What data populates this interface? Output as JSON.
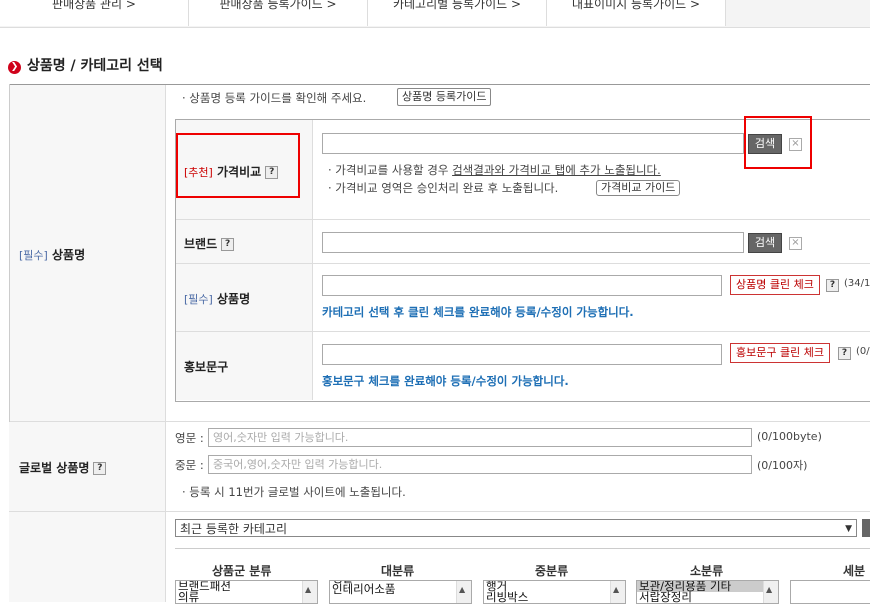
{
  "top_tabs": [
    {
      "label": "판매상품 관리 >"
    },
    {
      "label": "판매상품 등록가이드 >"
    },
    {
      "label": "카테고리별 등록가이드 >"
    },
    {
      "label": "대표이미지 등록가이드 >"
    }
  ],
  "section_title": "상품명 / 카테고리 선택",
  "product_name_section": {
    "req_tag": "[필수]",
    "label": "상품명",
    "guide_text": "· 상품명 등록 가이드를 확인해 주세요.",
    "guide_button": "상품명 등록가이드",
    "price_compare": {
      "rec_tag": "[추천]",
      "label": "가격비교",
      "search_button": "검색",
      "close": "×",
      "note1_prefix": "· 가격비교를 사용할 경우 ",
      "note1_link": "검색결과와 가격비교 탭에 추가 노출됩니다.",
      "note2": "· 가격비교 영역은 승인처리 완료 후 노출됩니다.",
      "note2_button": "가격비교 가이드"
    },
    "brand": {
      "label": "브랜드",
      "search_button": "검색",
      "close": "×"
    },
    "name": {
      "req_tag": "[필수]",
      "label": "상품명",
      "check_button": "상품명 클린 체크",
      "counter": "(34/1",
      "note": "카테고리 선택 후 클린 체크를 완료해야 등록/수정이 가능합니다."
    },
    "promo": {
      "label": "홍보문구",
      "check_button": "홍보문구 클린 체크",
      "counter": "(0/",
      "note": "홍보문구 체크를 완료해야 등록/수정이 가능합니다."
    },
    "question_mark": "?"
  },
  "global_name": {
    "label": "글로벌 상품명",
    "en_label": "영문 :",
    "en_placeholder": "영어,숫자만 입력 가능합니다.",
    "en_counter": "(0/100byte)",
    "cn_label": "중문 :",
    "cn_placeholder": "중국어,영어,숫자만 입력 가능합니다.",
    "cn_counter": "(0/100자)",
    "note": "· 등록 시 11번가 글로벌 사이트에 노출됩니다."
  },
  "category": {
    "recent_select": "최근 등록한 카테고리",
    "columns": [
      {
        "header": "상품군 분류",
        "items": [
          "브랜드패션",
          "의류"
        ],
        "selected": -1
      },
      {
        "header": "대분류",
        "items": [
          "생활",
          "인테리어소품"
        ],
        "selected": -1
      },
      {
        "header": "중분류",
        "items": [
          "행거",
          "리빙박스"
        ],
        "selected": -1
      },
      {
        "header": "소분류",
        "items": [
          "보관/정리용품 기타",
          "서랍장정리"
        ],
        "selected": 0
      },
      {
        "header": "세분",
        "items": [],
        "selected": -1
      }
    ]
  }
}
